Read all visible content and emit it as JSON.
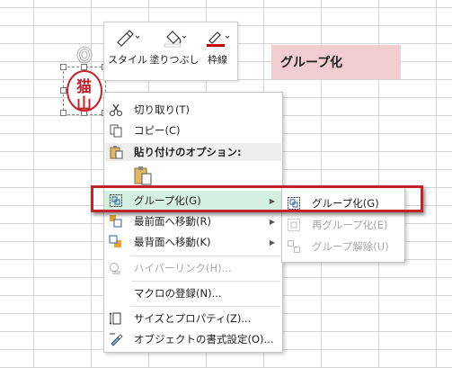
{
  "toolbar": {
    "style_label": "スタイル",
    "fill_label": "塗りつぶし",
    "outline_label": "枠線",
    "outline_color": "#c00000"
  },
  "stamp": {
    "chars": [
      "猫",
      "山"
    ],
    "color": "#c0232a"
  },
  "note": {
    "text": "グループ化",
    "bg": "#f2cdcf"
  },
  "menu": {
    "cut": "切り取り(T)",
    "copy": "コピー(C)",
    "paste_header": "貼り付けのオプション:",
    "group": "グループ化(G)",
    "bring_front": "最前面へ移動(R)",
    "send_back": "最背面へ移動(K)",
    "hyperlink": "ハイパーリンク(H)...",
    "macro": "マクロの登録(N)...",
    "size_props": "サイズとプロパティ(Z)...",
    "format": "オブジェクトの書式設定(O)..."
  },
  "submenu": {
    "group": "グループ化(G)",
    "regroup": "再グループ化(E)",
    "ungroup": "グループ解除(U)"
  },
  "colors": {
    "highlight": "#d3f0e0",
    "callout": "#c0232a"
  }
}
